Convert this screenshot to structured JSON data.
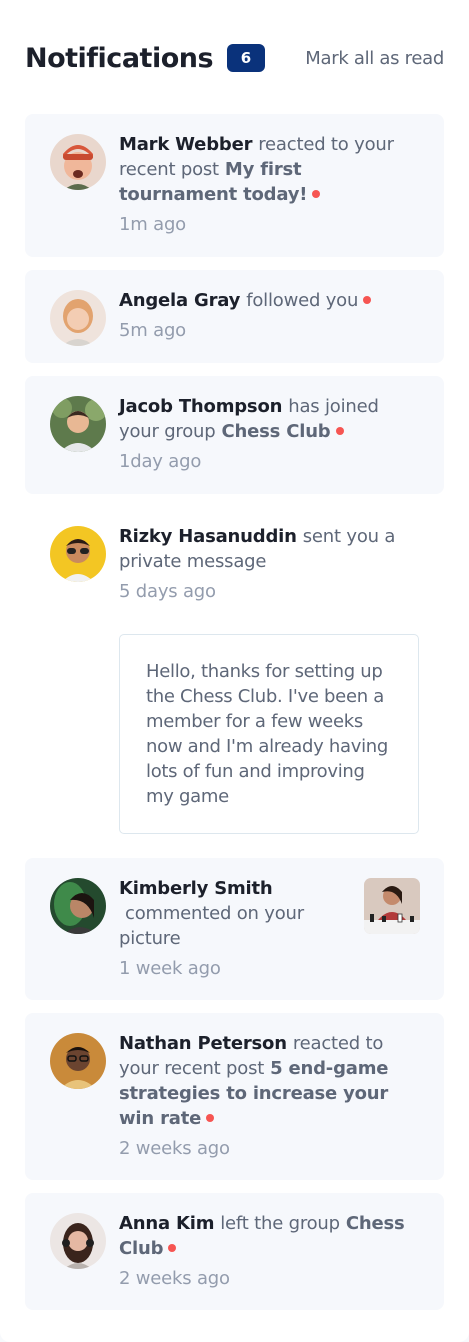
{
  "header": {
    "title": "Notifications",
    "unread_count": "6",
    "mark_all_label": "Mark all as read"
  },
  "notifications": [
    {
      "name": "Mark Webber",
      "action": "reacted to your recent post",
      "target": "My first tournament today!",
      "time": "1m ago",
      "unread": true
    },
    {
      "name": "Angela Gray",
      "action": "followed you",
      "time": "5m ago",
      "unread": true
    },
    {
      "name": "Jacob Thompson",
      "action": "has joined your group",
      "target": "Chess Club",
      "time": "1day ago",
      "unread": true
    },
    {
      "name": "Rizky Hasanuddin",
      "action": "sent you a private message",
      "time": "5 days ago",
      "message": "Hello, thanks for setting up the Chess Club. I've been a member for a few weeks now and I'm already having lots of fun and improving my game",
      "unread": false
    },
    {
      "name": "Kimberly Smith",
      "action": "commented on your picture",
      "time": "1 week ago",
      "unread": false
    },
    {
      "name": "Nathan Peterson",
      "action": "reacted to your recent post",
      "target": "5 end-game strategies to increase your win rate",
      "time": "2 weeks ago",
      "unread": true
    },
    {
      "name": "Anna Kim",
      "action": "left the group",
      "target": "Chess Club",
      "time": "2 weeks ago",
      "unread": true
    }
  ],
  "colors": {
    "accent_badge": "#0a327b",
    "unread_dot": "#f65552",
    "card_unread_bg": "#f6f8fc",
    "name_text": "#1c202b",
    "body_text": "#5e6778",
    "time_text": "#939cad"
  }
}
